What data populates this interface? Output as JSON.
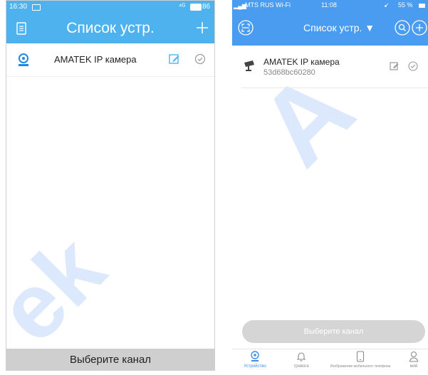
{
  "android": {
    "status_time": "16:30",
    "signal": "⁴ᴳ",
    "battery": "86",
    "title": "Список устр.",
    "device_name": "AMATEK IP камера",
    "footer_button": "Выберите канал",
    "colors": {
      "header": "#4db2ee",
      "accent": "#1e88e5",
      "footer": "#cfcfcf"
    }
  },
  "ios": {
    "carrier": "MTS RUS Wi-Fi",
    "status_time": "11:08",
    "battery": "55 %",
    "title": "Список устр. ▼",
    "device_name": "AMATEK IP камера",
    "device_serial": "53d68bc60280",
    "select_button": "Выберите канал",
    "tabs": [
      "Устройство",
      "тревога",
      "Изображение мобильного телефона",
      "мой"
    ],
    "colors": {
      "header": "#4a9cf0",
      "tab_active": "#3b8fe8",
      "tab_inactive": "#8a8a8a",
      "button": "#d5d5d5"
    }
  }
}
